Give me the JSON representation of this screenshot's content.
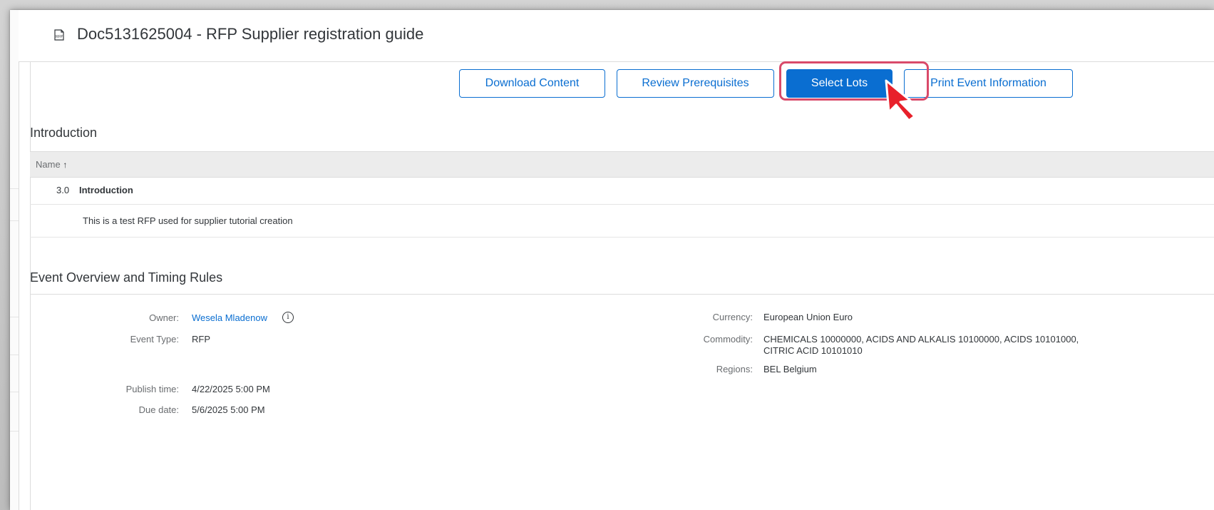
{
  "page": {
    "title": "Doc5131625004 - RFP Supplier registration guide"
  },
  "toolbar": {
    "download_content": "Download Content",
    "review_prerequisites": "Review Prerequisites",
    "select_lots": "Select Lots",
    "print_event_information": "Print Event Information"
  },
  "introduction": {
    "heading": "Introduction",
    "column_header": "Name",
    "sort_indicator": "↑",
    "rows": [
      {
        "number": "3.0",
        "name": "Introduction"
      }
    ],
    "description": "This is a test RFP used for supplier tutorial creation"
  },
  "event_overview": {
    "heading": "Event Overview and Timing Rules",
    "left": {
      "owner_label": "Owner:",
      "owner_value": "Wesela Mladenow",
      "event_type_label": "Event Type:",
      "event_type_value": "RFP",
      "publish_time_label": "Publish time:",
      "publish_time_value": "4/22/2025 5:00 PM",
      "due_date_label": "Due date:",
      "due_date_value": "5/6/2025 5:00 PM"
    },
    "right": {
      "currency_label": "Currency:",
      "currency_value": "European Union Euro",
      "commodity_label": "Commodity:",
      "commodity_line1": "CHEMICALS 10000000, ACIDS AND ALKALIS 10100000, ACIDS 10101000,",
      "commodity_line2": "CITRIC ACID 10101010",
      "regions_label": "Regions:",
      "regions_value": "BEL Belgium"
    }
  },
  "colors": {
    "accent": "#0a6ed1",
    "highlight_border": "#d94a6a",
    "cursor": "#e8202a"
  },
  "icons": {
    "title_icon": "rfp-document-icon",
    "info_icon": "info-icon",
    "pointer": "mouse-pointer-icon"
  }
}
